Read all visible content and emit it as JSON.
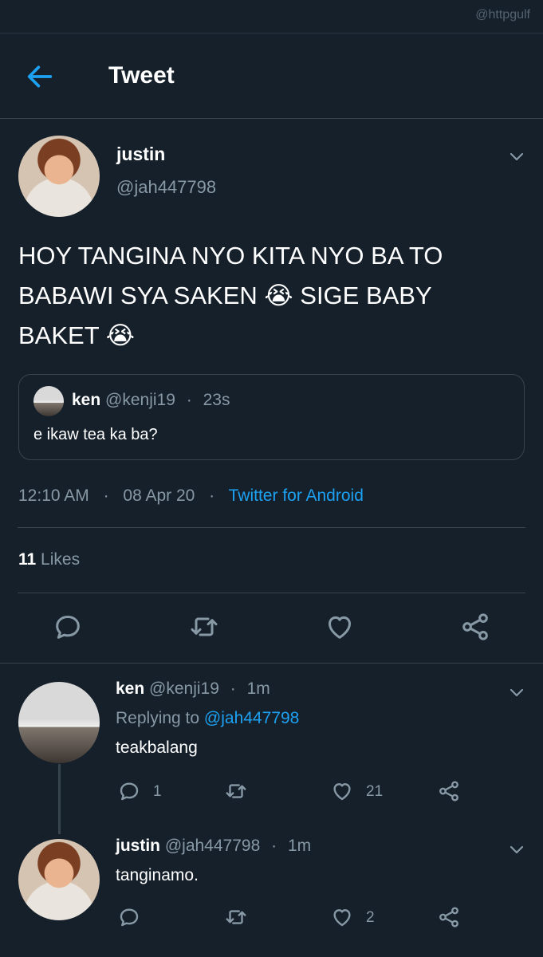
{
  "watermark": "@httpgulf",
  "header": {
    "title": "Tweet",
    "back_icon": "arrow-left-icon"
  },
  "tweet": {
    "author_name": "justin",
    "author_handle": "@jah447798",
    "text_line1": "HOY TANGINA NYO KITA NYO BA TO",
    "text_line2": "BABAWI SYA SAKEN",
    "text_line2b": "SIGE BABY",
    "text_line3": "BAKET",
    "emoji": "😭",
    "quote": {
      "name": "ken",
      "handle": "@kenji19",
      "sep": "·",
      "time": "23s",
      "text": "e ikaw tea ka ba?"
    },
    "time": "12:10 AM",
    "sep": "·",
    "date": "08 Apr 20",
    "source": "Twitter for Android",
    "likes_count": "11",
    "likes_label": "Likes"
  },
  "replies": [
    {
      "name": "ken",
      "handle": "@kenji19",
      "sep": "·",
      "time": "1m",
      "replying_label": "Replying to",
      "replying_to": "@jah447798",
      "text": "teakbalang",
      "reply_count": "1",
      "retweet_count": "",
      "like_count": "21"
    },
    {
      "name": "justin",
      "handle": "@jah447798",
      "sep": "·",
      "time": "1m",
      "text": "tanginamo.",
      "reply_count": "",
      "retweet_count": "",
      "like_count": "2"
    }
  ],
  "colors": {
    "background": "#15202b",
    "accent": "#1da1f2",
    "secondary_text": "#8899a6",
    "divider": "#38444d"
  }
}
